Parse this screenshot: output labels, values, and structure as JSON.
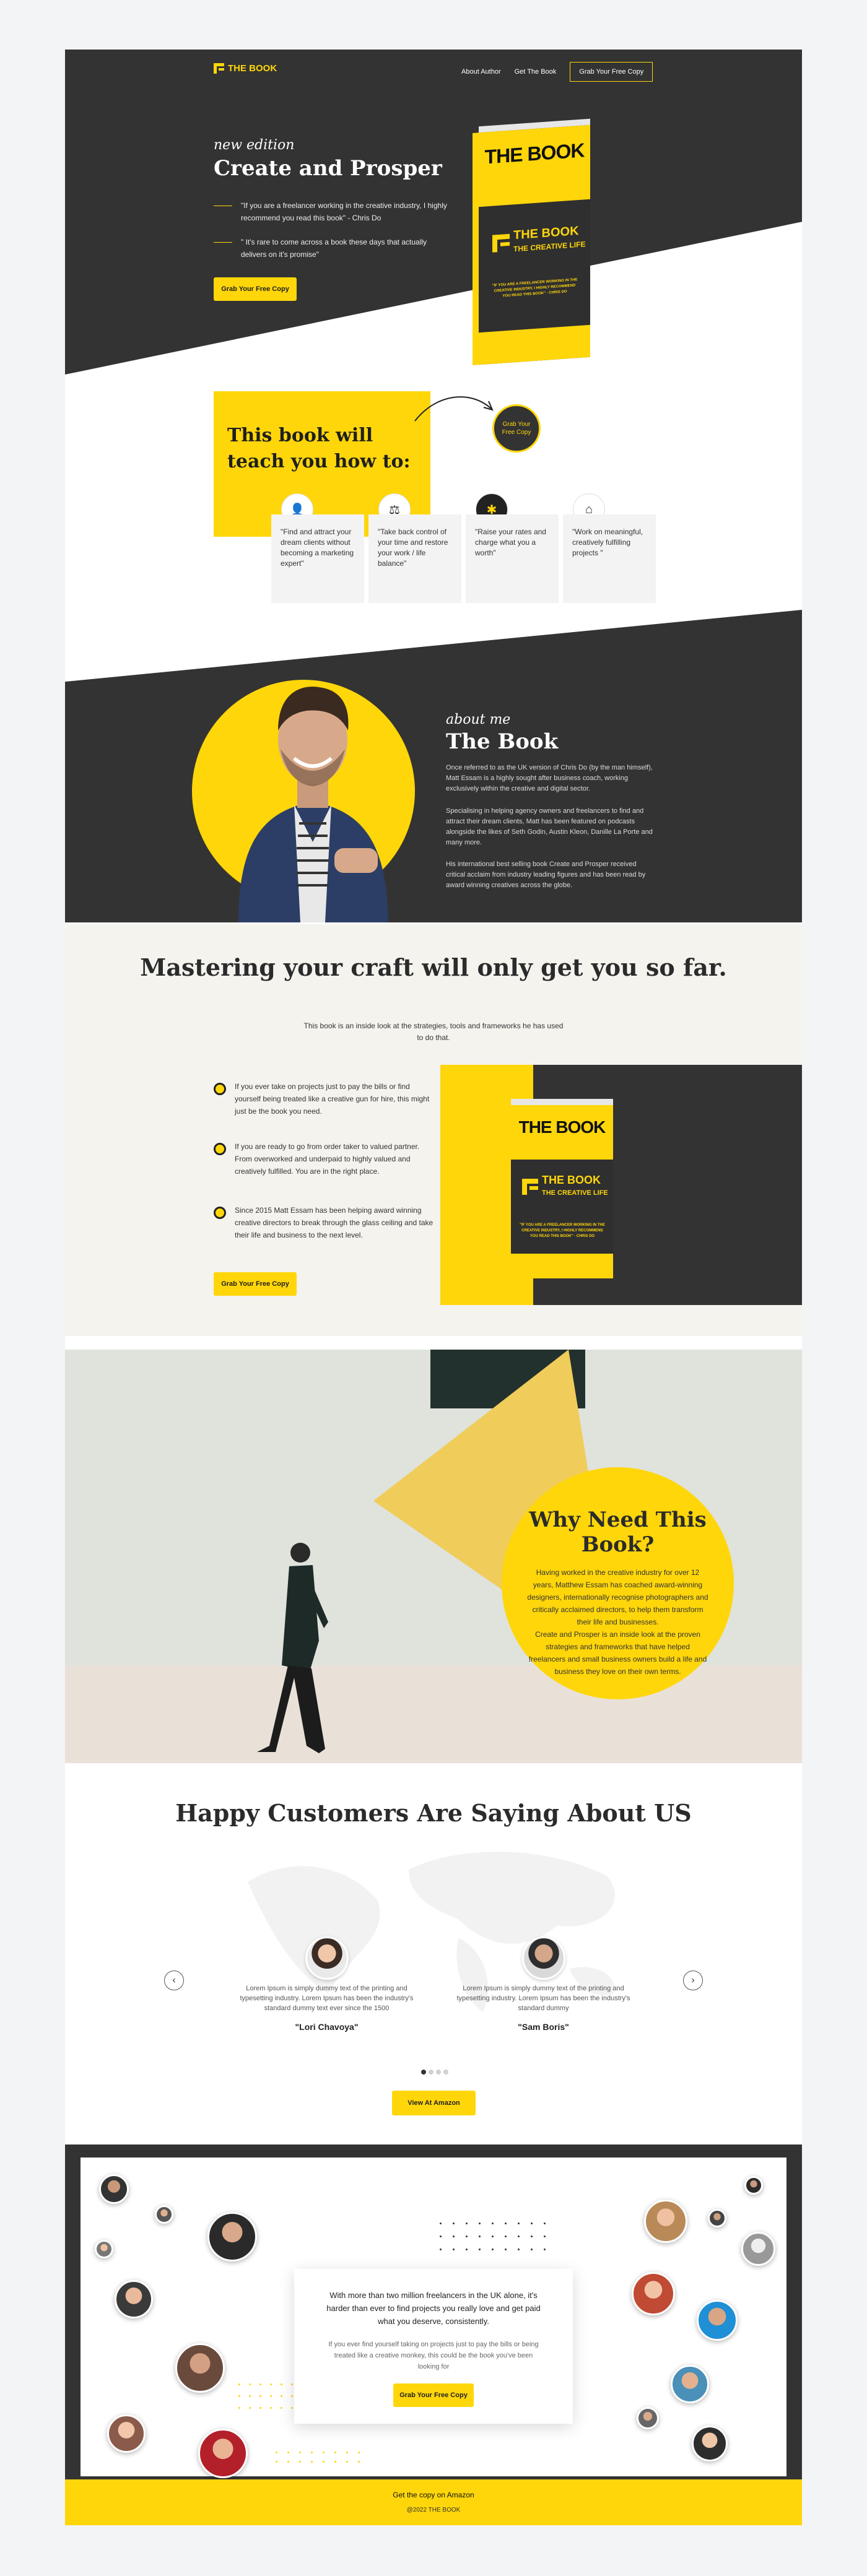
{
  "nav": {
    "logo": "THE BOOK",
    "links": [
      "About Author",
      "Get The Book"
    ],
    "cta": "Grab Your Free Copy"
  },
  "hero": {
    "tag": "new edition",
    "title": "Create and Prosper",
    "quote1": "\"If you are a freelancer working in the creative industry, I highly recommend you read this book\" - Chris Do",
    "quote2": "\" It's rare to come across a book these days that actually delivers on it's promise\"",
    "button": "Grab Your Free Copy"
  },
  "book": {
    "title": "THE BOOK",
    "logo": "THE BOOK",
    "subtitle": "THE CREATIVE LIFE",
    "tagline": "\"IF YOU ARE A FREELANCER WORKING IN THE CREATIVE INDUSTRY, I HIGHLY RECOMMEND YOU READ THIS BOOK\" - CHRIS DO"
  },
  "teach": {
    "title": "This book will teach you how to:",
    "circle": "Grab Your Free Copy",
    "cards": [
      "\"Find and attract your dream clients without becoming a marketing expert\"",
      "\"Take back control of your time and restore your work / life balance\"",
      "\"Raise your rates and charge what you a worth\"",
      "\"Work on meaningful, creatively fulfilling projects \""
    ]
  },
  "about": {
    "tag": "about me",
    "title": "The Book",
    "p1": "Once referred to as the UK version of Chris Do (by the man himself), Matt Essam is a highly sought after business coach, working exclusively within the creative and digital sector.",
    "p2": "Specialising in helping agency owners and freelancers to find and attract their dream clients, Matt has been featured on podcasts alongside the likes of Seth Godin, Austin Kleon, Danille La Porte and many more.",
    "p3": "His international best selling book Create and Prosper received critical acclaim from industry leading figures and has been read by award winning creatives across the globe."
  },
  "mastering": {
    "title": "Mastering your craft will only get you so far.",
    "subtitle": "This book is an inside look at the strategies, tools and frameworks he has used to do that.",
    "items": [
      "If you ever take on projects just to pay the bills or find yourself being treated like a creative gun for hire, this might just be the book you need.",
      "If you are ready to go from order taker to valued partner. From overworked and underpaid to highly valued and creatively fulfilled. You are in the right place.",
      "Since 2015 Matt Essam has been helping award winning creative directors to break through the glass ceiling and take their life and business to the next level."
    ],
    "button": "Grab Your Free Copy"
  },
  "why": {
    "title": "Why Need This Book?",
    "body1": "Having worked in the creative industry for over 12 years, Matthew Essam has coached award-winning designers, internationally recognise photographers and critically acclaimed directors, to help them transform their life and businesses.",
    "body2": "Create and Prosper is an inside look at the proven strategies and frameworks that have helped freelancers and small business owners build a life and business they love on their own terms."
  },
  "customers": {
    "title": "Happy Customers Are Saying About US",
    "prev": "‹",
    "next": "›",
    "reviews": [
      {
        "text": "Lorem Ipsum is simply dummy text of the printing and typesetting industry. Lorem Ipsum has been the industry's standard dummy text ever since the 1500",
        "name": "\"Lori Chavoya\""
      },
      {
        "text": "Lorem Ipsum is simply dummy text of the printing and typesetting industry. Lorem Ipsum has been the industry's standard dummy",
        "name": "\"Sam Boris\""
      }
    ],
    "button": "View At Amazon"
  },
  "bottom": {
    "strong": "With more than two million freelancers in the UK alone, it's harder than ever to find projects you really love and get paid what you deserve, consistently.",
    "p": "If you ever find yourself taking on projects just to pay the bills or being treated like a creative monkey, this could be the book you've been looking for",
    "button": "Grab Your Free Copy"
  },
  "footer": {
    "link": "Get the copy on Amazon",
    "copy": "@2022 THE BOOK"
  },
  "colors": {
    "accent": "#ffd60a",
    "dark": "#333333"
  }
}
